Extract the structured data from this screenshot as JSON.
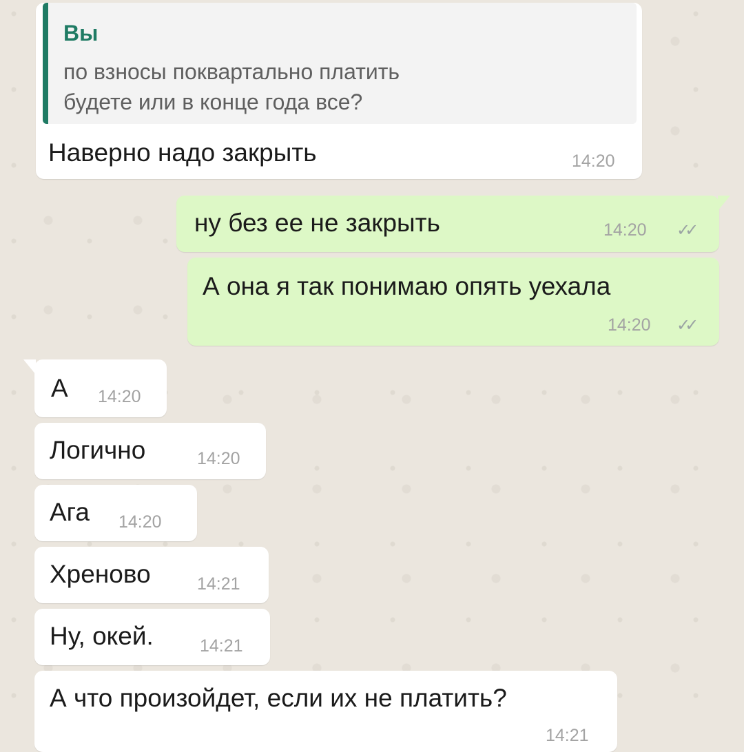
{
  "quoted_message": {
    "author": "Вы",
    "line1": "по                  взносы поквартально платить",
    "line2": "будете или в конце года все?"
  },
  "messages": [
    {
      "direction": "in",
      "text": "Наверно                 надо закрыть",
      "time": "14:20"
    },
    {
      "direction": "out",
      "text": "ну без                     ее не закрыть",
      "time": "14:20",
      "status": "read"
    },
    {
      "direction": "out",
      "text": "А она я так понимаю опять уехала",
      "time": "14:20",
      "status": "read"
    },
    {
      "direction": "in",
      "text": "А",
      "time": "14:20"
    },
    {
      "direction": "in",
      "text": "Логично",
      "time": "14:20"
    },
    {
      "direction": "in",
      "text": "Ага",
      "time": "14:20"
    },
    {
      "direction": "in",
      "text": "Хреново",
      "time": "14:21"
    },
    {
      "direction": "in",
      "text": "Ну, окей.",
      "time": "14:21"
    },
    {
      "direction": "in",
      "text": "А что произойдет, если их не платить?",
      "time": "14:21"
    }
  ],
  "read_receipt_icon": "double-check-icon",
  "colors": {
    "incoming_bubble": "#ffffff",
    "outgoing_bubble": "#ddf8c6",
    "quote_accent": "#1f7b64",
    "timestamp": "#a3a3a3",
    "chat_background": "#ebe6de"
  }
}
